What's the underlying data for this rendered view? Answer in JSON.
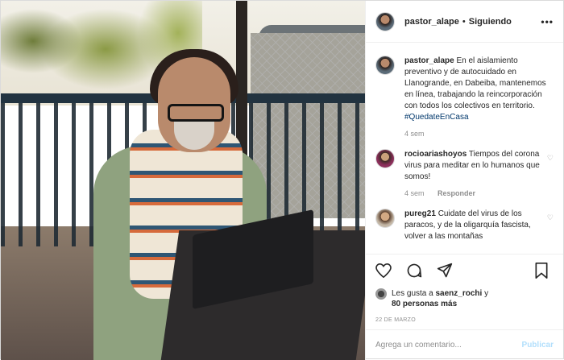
{
  "header": {
    "username": "pastor_alape",
    "separator": "•",
    "follow_status": "Siguiendo",
    "more_icon": "more-dots-icon"
  },
  "caption": {
    "username": "pastor_alape",
    "text": "En el aislamiento preventivo y de autocuidado en Llanogrande, en Dabeiba, mantenemos en línea, trabajando la reincorporación con todos los colectivos en territorio.",
    "hashtag": "#QuedateEnCasa",
    "time": "4 sem"
  },
  "comments": [
    {
      "username": "rocioariashoyos",
      "text": "Tiempos del corona virus para meditar en lo humanos que somos!",
      "time": "4 sem",
      "reply": "Responder"
    },
    {
      "username": "pureg21",
      "text": "Cuidate del virus de los paracos, y de la oligarquía fascista, volver a las montañas"
    }
  ],
  "actions": {
    "like_icon": "heart-icon",
    "comment_icon": "comment-icon",
    "share_icon": "share-icon",
    "save_icon": "bookmark-icon"
  },
  "likes": {
    "prefix": "Les gusta a",
    "user": "saenz_rochi",
    "conj": "y",
    "others": "80 personas más"
  },
  "date": "22 DE MARZO",
  "add_comment": {
    "placeholder": "Agrega un comentario...",
    "publish": "Publicar"
  },
  "colors": {
    "link": "#00376b",
    "publish_disabled": "#b2dffc",
    "muted": "#8e8e8e"
  }
}
